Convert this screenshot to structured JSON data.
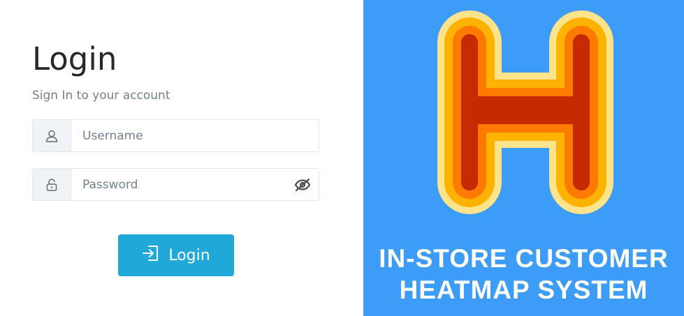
{
  "login": {
    "title": "Login",
    "subtitle": "Sign In to your account",
    "username_placeholder": "Username",
    "password_placeholder": "Password",
    "button_label": "Login"
  },
  "brand": {
    "line1": "IN-STORE CUSTOMER",
    "line2": "HEATMAP SYSTEM",
    "logo_letter": "H"
  },
  "icons": {
    "username": "user-icon",
    "password": "lock-icon",
    "toggle": "eye-slash-icon",
    "button": "sign-in-icon"
  },
  "colors": {
    "button": "#20a8d8",
    "brand_bg": "#3d9cf7",
    "logo_outer": "#fde38a",
    "logo_ring1": "#ffb300",
    "logo_ring2": "#ff7a00",
    "logo_core": "#c62b00"
  }
}
